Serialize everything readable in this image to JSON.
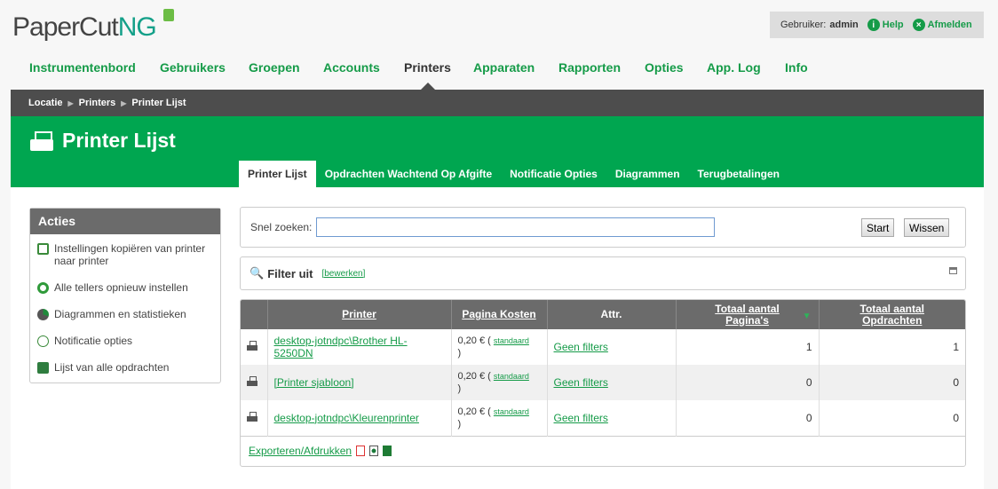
{
  "logo": {
    "text": "PaperCut",
    "suffix": "NG"
  },
  "user": {
    "label": "Gebruiker:",
    "name": "admin",
    "help": "Help",
    "logout": "Afmelden"
  },
  "nav": [
    "Instrumentenbord",
    "Gebruikers",
    "Groepen",
    "Accounts",
    "Printers",
    "Apparaten",
    "Rapporten",
    "Opties",
    "App. Log",
    "Info"
  ],
  "nav_active": "Printers",
  "breadcrumb": [
    "Locatie",
    "Printers",
    "Printer Lijst"
  ],
  "page_title": "Printer Lijst",
  "tabs": [
    "Printer Lijst",
    "Opdrachten Wachtend Op Afgifte",
    "Notificatie Opties",
    "Diagrammen",
    "Terugbetalingen"
  ],
  "sidebar": {
    "title": "Acties",
    "items": [
      {
        "label": "Instellingen kopiëren van printer naar printer",
        "icon": "copy-icon"
      },
      {
        "label": "Alle tellers opnieuw instellen",
        "icon": "reset-icon"
      },
      {
        "label": "Diagrammen en statistieken",
        "icon": "pie-chart-icon"
      },
      {
        "label": "Notificatie opties",
        "icon": "notification-icon"
      },
      {
        "label": "Lijst van alle opdrachten",
        "icon": "job-list-icon"
      }
    ]
  },
  "search": {
    "label": "Snel zoeken:",
    "value": "",
    "start": "Start",
    "clear": "Wissen"
  },
  "filter": {
    "label": "Filter uit",
    "edit": "[bewerken]"
  },
  "table": {
    "headers": [
      "Printer",
      "Pagina Kosten",
      "Attr.",
      "Totaal aantal Pagina's",
      "Totaal aantal Opdrachten"
    ],
    "rows": [
      {
        "printer": "desktop-jotndpc\\Brother HL-5250DN",
        "cost": "0,20 €",
        "cost_note": "standaard",
        "attr": "Geen filters",
        "pages": "1",
        "jobs": "1"
      },
      {
        "printer": "[Printer sjabloon]",
        "cost": "0,20 €",
        "cost_note": "standaard",
        "attr": "Geen filters",
        "pages": "0",
        "jobs": "0"
      },
      {
        "printer": "desktop-jotndpc\\Kleurenprinter",
        "cost": "0,20 €",
        "cost_note": "standaard",
        "attr": "Geen filters",
        "pages": "0",
        "jobs": "0"
      }
    ]
  },
  "export": {
    "label": "Exporteren/Afdrukken"
  },
  "colors": {
    "green": "#00a650",
    "link": "#159b48",
    "dark": "#4d4d4d"
  }
}
